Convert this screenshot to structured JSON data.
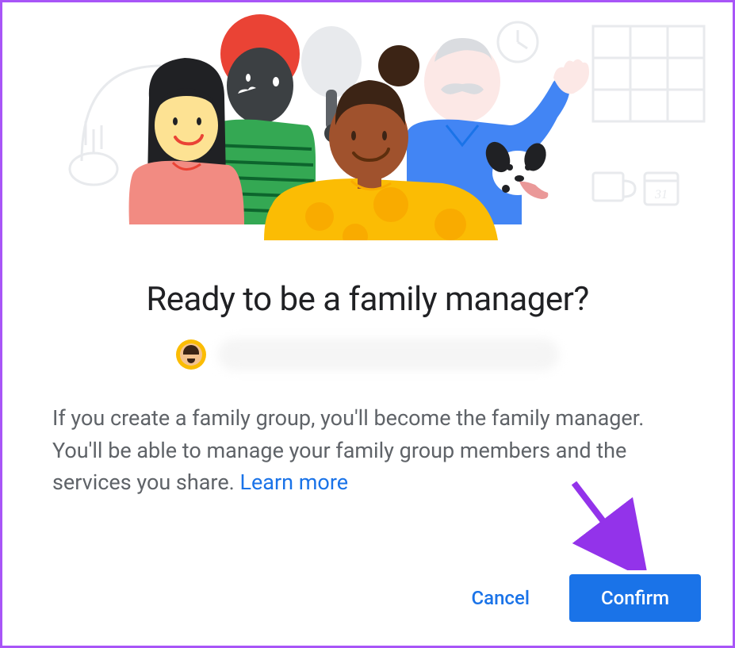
{
  "dialog": {
    "title": "Ready to be a family manager?",
    "description": "If you create a family group, you'll become the family manager. You'll be able to manage your family group members and the services you share. ",
    "learn_more": "Learn more",
    "cancel_label": "Cancel",
    "confirm_label": "Confirm"
  },
  "colors": {
    "accent": "#1a73e8",
    "border": "#a855f7",
    "text_primary": "#202124",
    "text_secondary": "#5f6368"
  }
}
